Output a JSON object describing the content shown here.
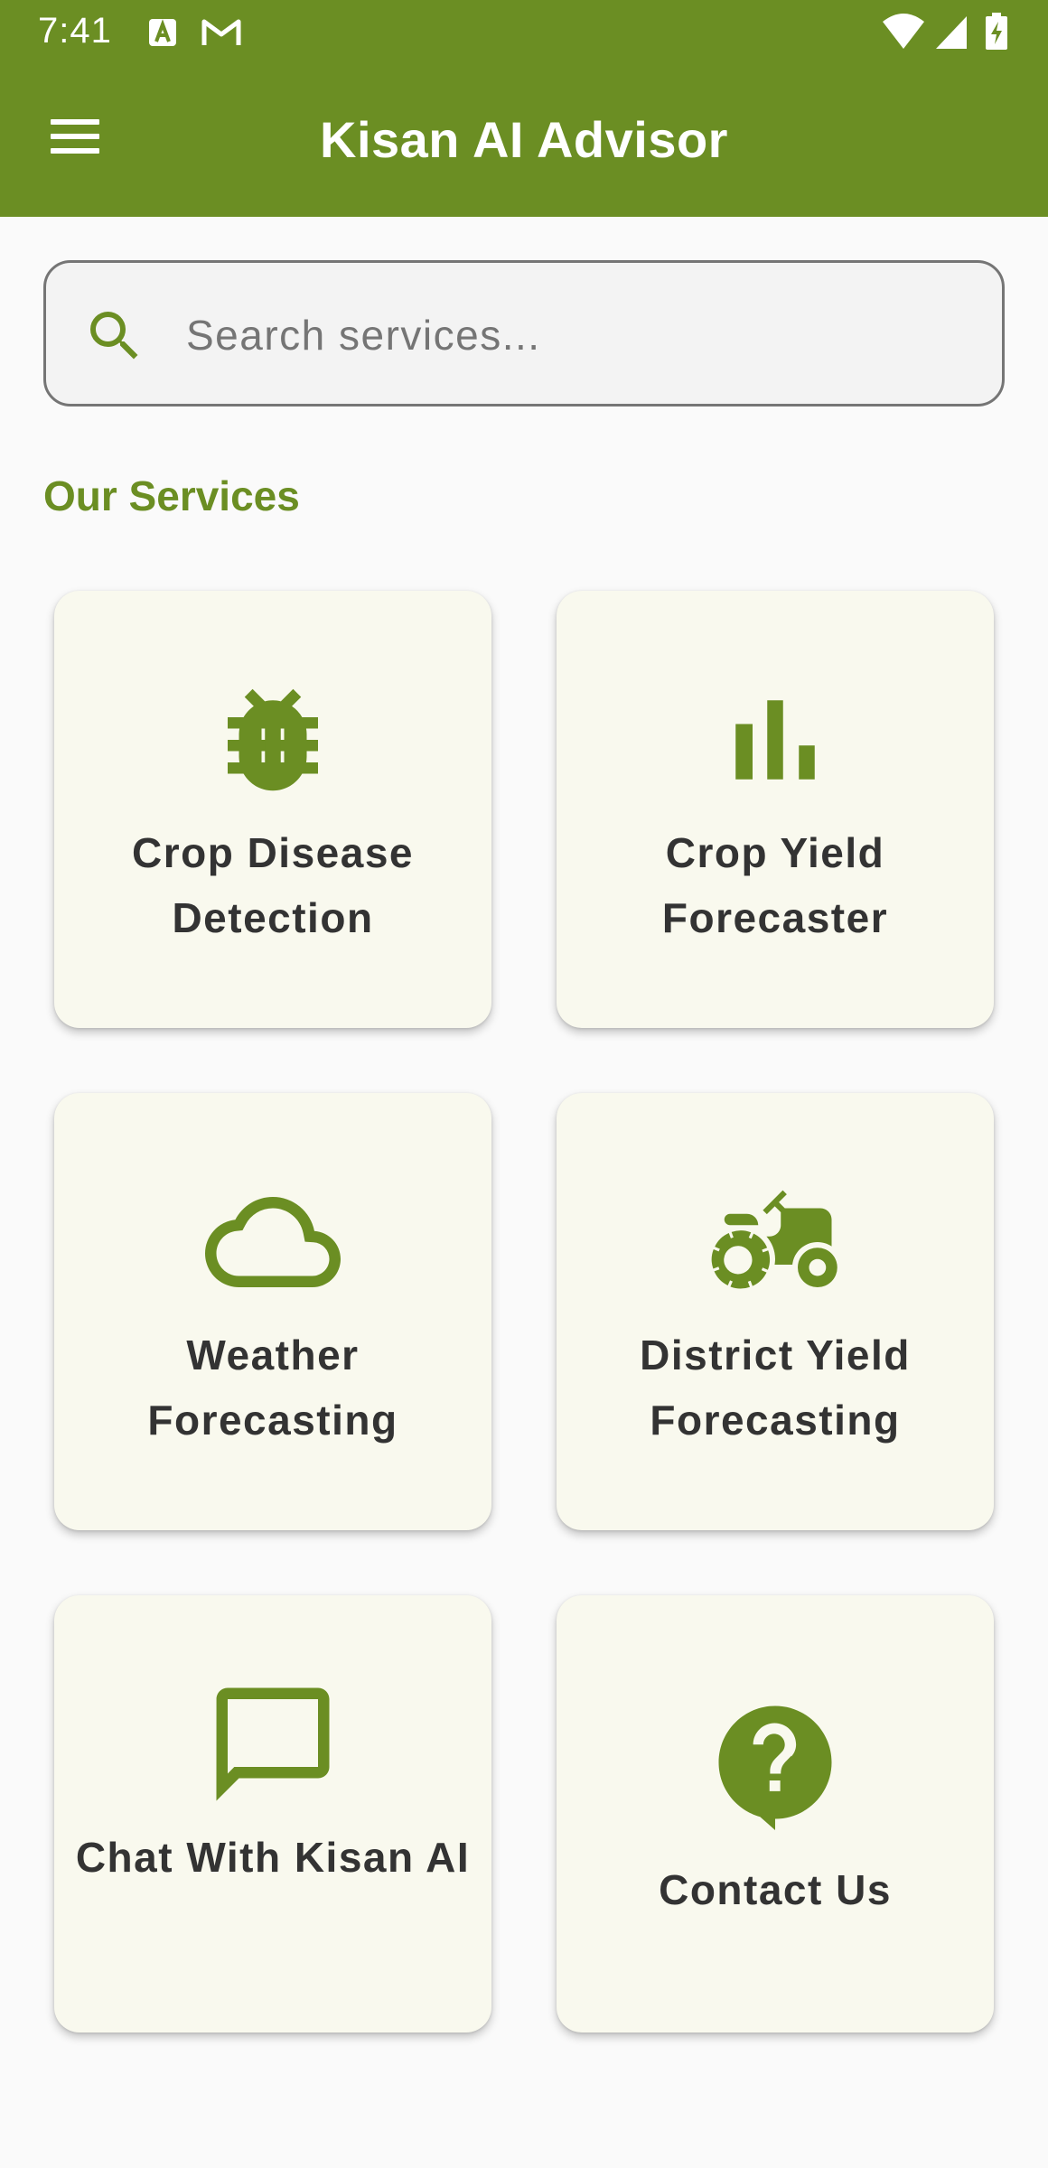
{
  "status_bar": {
    "time": "7:41",
    "notification_icons": [
      "translate-app-icon",
      "gmail-icon"
    ],
    "system_icons": [
      "wifi-icon",
      "cellular-signal-icon",
      "battery-charging-icon"
    ]
  },
  "app_bar": {
    "title": "Kisan AI Advisor",
    "menu_icon": "hamburger-menu-icon"
  },
  "search": {
    "placeholder": "Search services...",
    "value": "",
    "icon": "search-icon"
  },
  "section_title": "Our Services",
  "services": [
    {
      "label": "Crop Disease Detection",
      "icon": "bug-icon"
    },
    {
      "label": "Crop Yield Forecaster",
      "icon": "bar-chart-icon"
    },
    {
      "label": "Weather Forecasting",
      "icon": "cloud-icon"
    },
    {
      "label": "District Yield Forecasting",
      "icon": "tractor-icon"
    },
    {
      "label": "Chat With Kisan AI",
      "icon": "chat-bubble-icon"
    },
    {
      "label": "Contact Us",
      "icon": "help-bubble-icon"
    }
  ],
  "colors": {
    "primary": "#6b8e23",
    "card_background": "#f9f9ee",
    "text": "#333333",
    "page_background": "#fafafa"
  }
}
